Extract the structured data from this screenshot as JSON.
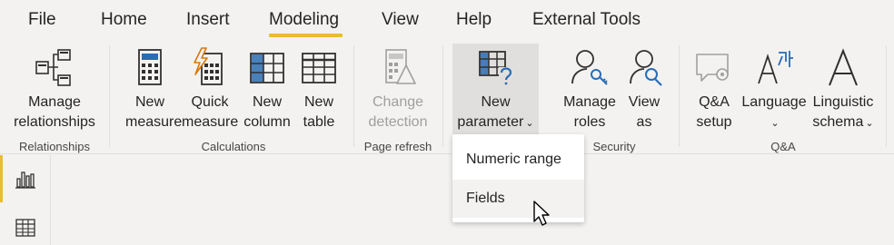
{
  "menu": {
    "file": "File",
    "home": "Home",
    "insert": "Insert",
    "modeling": "Modeling",
    "view": "View",
    "help": "Help",
    "external_tools": "External Tools",
    "active": "Modeling"
  },
  "ribbon": {
    "relationships": {
      "group_label": "Relationships",
      "manage_relationships": [
        "Manage",
        "relationships"
      ]
    },
    "calculations": {
      "group_label": "Calculations",
      "new_measure": [
        "New",
        "measure"
      ],
      "quick_measure": [
        "Quick",
        "measure"
      ],
      "new_column": [
        "New",
        "column"
      ],
      "new_table": [
        "New",
        "table"
      ]
    },
    "page_refresh": {
      "group_label": "Page refresh",
      "change_detection": [
        "Change",
        "detection"
      ]
    },
    "parameters": {
      "new_parameter": [
        "New",
        "parameter"
      ]
    },
    "security": {
      "group_label": "Security",
      "manage_roles": [
        "Manage",
        "roles"
      ],
      "view_as": [
        "View",
        "as"
      ]
    },
    "qa": {
      "group_label": "Q&A",
      "qa_setup": [
        "Q&A",
        "setup"
      ],
      "language": [
        "Language"
      ],
      "linguistic_schema": [
        "Linguistic",
        "schema"
      ]
    }
  },
  "dropdown": {
    "items": [
      "Numeric range",
      "Fields"
    ],
    "hovered": "Fields"
  },
  "colors": {
    "accent": "#e8bd2f",
    "icon_blue": "#2b6cb3",
    "icon_dark": "#323130",
    "icon_orange": "#d97706"
  },
  "icons": {
    "manage_relationships": "relationships-icon",
    "new_measure": "calculator-icon",
    "quick_measure": "quick-measure-icon",
    "new_column": "column-icon",
    "new_table": "table-icon",
    "change_detection": "change-detection-icon",
    "new_parameter": "parameter-icon",
    "manage_roles": "roles-icon",
    "view_as": "view-as-icon",
    "qa_setup": "qa-setup-icon",
    "language": "language-icon",
    "linguistic_schema": "linguistic-schema-icon",
    "rail_report": "report-icon",
    "rail_data": "data-icon",
    "cursor": "mouse-cursor-icon"
  }
}
